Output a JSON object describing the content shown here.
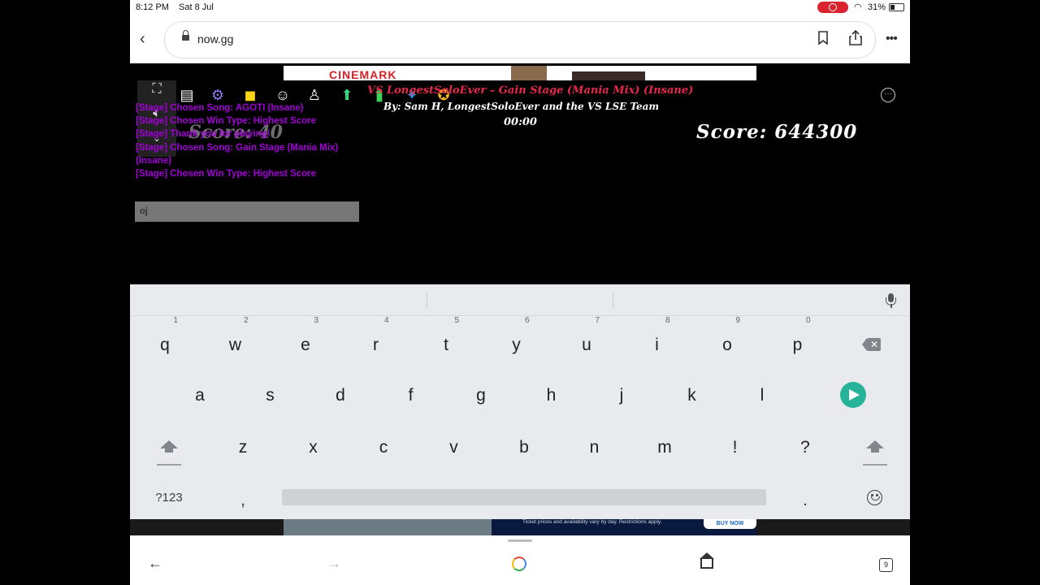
{
  "status_bar": {
    "time": "8:12 PM",
    "date": "Sat 8 Jul",
    "battery": "31%"
  },
  "browser": {
    "url": "now.gg"
  },
  "ad_top": {
    "brand": "CINEMARK"
  },
  "game": {
    "song_title_lead": "VS LongestSoloEver",
    "song_title_rest": " – Gain Stage (Mania Mix) (Insane)",
    "credits": "By: Sam H, LongestSoloEver and the VS LSE Team",
    "timer": "00:00",
    "score_left": "Score: 40",
    "score_right": "Score: 644300",
    "chat_lines": [
      "[Stage] Chosen Song: AGOTI (Insane)",
      "[Stage] Chosen Win Type: Highest Score",
      "[Stage] Thank you for playing!",
      "[Stage] Chosen Song: Gain Stage (Mania Mix)",
      "(Insane)",
      "[Stage] Chosen Win Type: Highest Score"
    ],
    "chat_input_value": "oj",
    "toolbar_icons": [
      "chat-icon",
      "gear-icon",
      "shop-bag-icon",
      "theater-masks-icon",
      "badge-icon",
      "arrow-up-icon",
      "bar-chart-icon",
      "twitter-icon",
      "star-badge-icon"
    ],
    "colors": {
      "chat": "#a100d6",
      "title": "#e8294a"
    }
  },
  "keyboard": {
    "row1": [
      {
        "k": "q",
        "h": "1"
      },
      {
        "k": "w",
        "h": "2"
      },
      {
        "k": "e",
        "h": "3"
      },
      {
        "k": "r",
        "h": "4"
      },
      {
        "k": "t",
        "h": "5"
      },
      {
        "k": "y",
        "h": "6"
      },
      {
        "k": "u",
        "h": "7"
      },
      {
        "k": "i",
        "h": "8"
      },
      {
        "k": "o",
        "h": "9"
      },
      {
        "k": "p",
        "h": "0"
      }
    ],
    "row2": [
      "a",
      "s",
      "d",
      "f",
      "g",
      "h",
      "j",
      "k",
      "l"
    ],
    "row3": [
      "z",
      "x",
      "c",
      "v",
      "b",
      "n",
      "m",
      "!",
      "?"
    ],
    "symbols_label": "?123",
    "comma": ",",
    "period": ".",
    "enter_color": "#26b39a"
  },
  "bottom_ad": {
    "fine_print": "Ticket prices and availability vary by day. Restrictions apply.",
    "cta": "BUY NOW"
  },
  "nav": {
    "tab_count": "9"
  }
}
